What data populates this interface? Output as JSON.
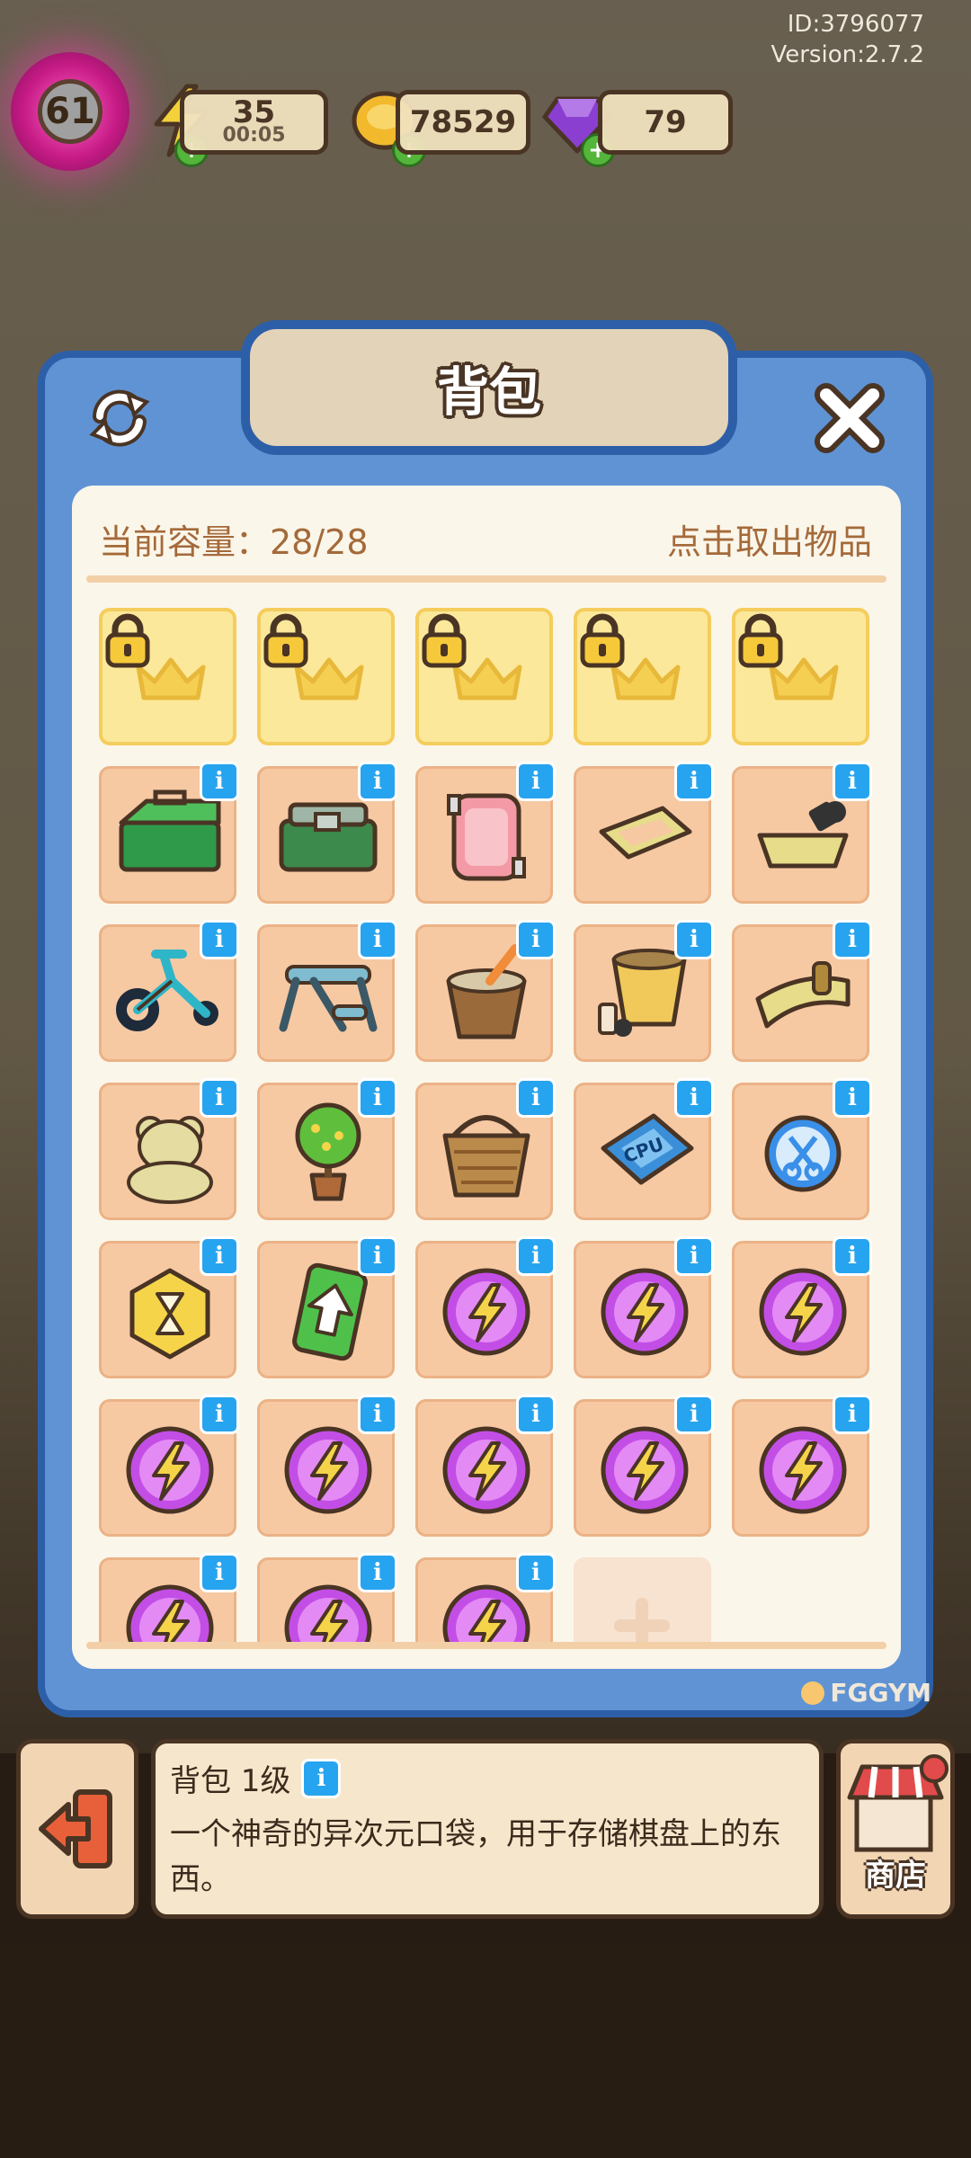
{
  "hud": {
    "id_text": "ID:3796077",
    "version_text": "Version:2.7.2",
    "level": "61",
    "energy": "35",
    "energy_timer": "00:05",
    "coins": "78529",
    "gems": "79"
  },
  "dialog": {
    "title": "背包",
    "capacity_label": "当前容量：28/28",
    "hint": "点击取出物品",
    "watermark": "FGGYM"
  },
  "slots": [
    {
      "type": "locked",
      "icon": "crown-icon"
    },
    {
      "type": "locked",
      "icon": "crown-icon"
    },
    {
      "type": "locked",
      "icon": "crown-icon"
    },
    {
      "type": "locked",
      "icon": "crown-icon"
    },
    {
      "type": "locked",
      "icon": "crown-icon"
    },
    {
      "type": "item",
      "icon": "green-toolbox-icon"
    },
    {
      "type": "item",
      "icon": "toolbox-icon"
    },
    {
      "type": "item",
      "icon": "pink-cushion-icon"
    },
    {
      "type": "item",
      "icon": "basket-frame-icon"
    },
    {
      "type": "item",
      "icon": "basket-dumbbell-icon"
    },
    {
      "type": "item",
      "icon": "exercise-bike-icon"
    },
    {
      "type": "item",
      "icon": "exercise-bench-icon"
    },
    {
      "type": "item",
      "icon": "mortar-icon"
    },
    {
      "type": "item",
      "icon": "paint-bucket-icon"
    },
    {
      "type": "item",
      "icon": "scroll-icon"
    },
    {
      "type": "item",
      "icon": "teddy-bear-icon"
    },
    {
      "type": "item",
      "icon": "potted-tree-icon"
    },
    {
      "type": "item",
      "icon": "wicker-basket-icon"
    },
    {
      "type": "item",
      "icon": "cpu-chip-icon",
      "text": "CPU"
    },
    {
      "type": "item",
      "icon": "scissors-orb-icon"
    },
    {
      "type": "item",
      "icon": "hourglass-hexagon-icon"
    },
    {
      "type": "item",
      "icon": "upgrade-card-icon"
    },
    {
      "type": "item",
      "icon": "energy-orb-icon"
    },
    {
      "type": "item",
      "icon": "energy-orb-icon"
    },
    {
      "type": "item",
      "icon": "energy-orb-icon"
    },
    {
      "type": "item",
      "icon": "energy-orb-icon"
    },
    {
      "type": "item",
      "icon": "energy-orb-icon"
    },
    {
      "type": "item",
      "icon": "energy-orb-icon"
    },
    {
      "type": "item",
      "icon": "energy-orb-icon"
    },
    {
      "type": "item",
      "icon": "energy-orb-icon"
    },
    {
      "type": "item",
      "icon": "energy-orb-icon"
    },
    {
      "type": "item",
      "icon": "energy-orb-icon"
    },
    {
      "type": "item",
      "icon": "energy-orb-icon"
    },
    {
      "type": "empty",
      "icon": "plus-icon"
    }
  ],
  "info_badge_text": "i",
  "footer": {
    "item_name": "背包 1级",
    "description": "一个神奇的异次元口袋，用于存储棋盘上的东西。",
    "shop_label": "商店"
  },
  "colors": {
    "dialog_blue": "#5f93d4",
    "dialog_border": "#2d5fa8",
    "panel_bg": "#fbf6ea",
    "slot_bg": "#f6c9a3",
    "locked_slot_bg": "#fbe89a",
    "text_brown": "#a46a3a",
    "info_blue": "#27a4ef",
    "energy_purple": "#c34ee6"
  }
}
